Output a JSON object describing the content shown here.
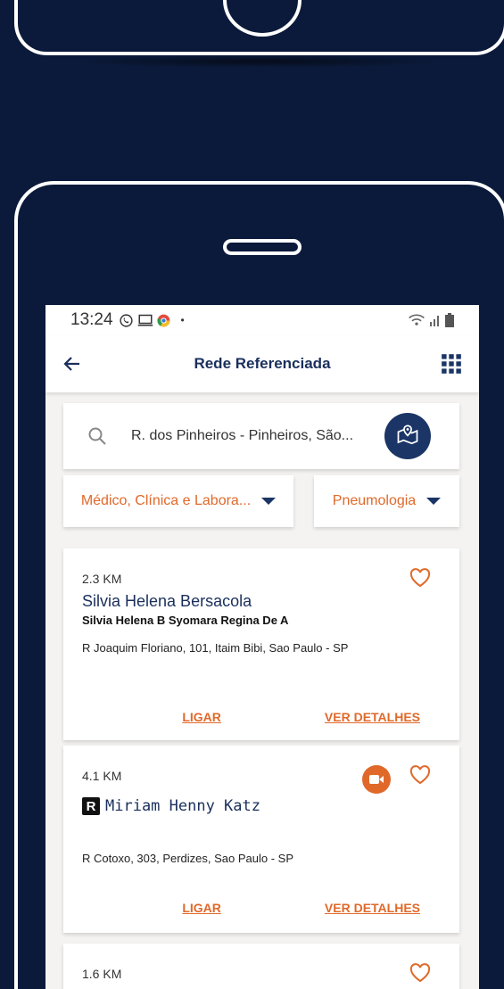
{
  "status_bar": {
    "time": "13:24",
    "left_icons": [
      "whatsapp-icon",
      "cast-icon",
      "chrome-icon",
      "dot-icon"
    ],
    "right_icons": [
      "wifi-icon",
      "signal-icon",
      "battery-icon"
    ]
  },
  "app_bar": {
    "title": "Rede Referenciada",
    "back_icon": "back-arrow-icon",
    "menu_icon": "grid-icon"
  },
  "search": {
    "value": "R. dos Pinheiros - Pinheiros, São...",
    "icon": "search-icon",
    "map_button_icon": "map-pin-icon"
  },
  "filters": [
    {
      "label": "Médico, Clínica e Labora..."
    },
    {
      "label": "Pneumologia"
    }
  ],
  "results": [
    {
      "distance": "2.3 KM",
      "name": "Silvia Helena Bersacola",
      "subname": "Silvia Helena B Syomara Regina De A",
      "address": "R Joaquim Floriano, 101, Itaim Bibi, Sao Paulo - SP",
      "call_label": "LIGAR",
      "details_label": "VER DETALHES"
    },
    {
      "distance": "4.1 KM",
      "badge": "R",
      "name": "Miriam Henny Katz",
      "address": "R Cotoxo, 303, Perdizes, Sao Paulo - SP",
      "call_label": "LIGAR",
      "details_label": "VER DETALHES",
      "video_icon": "video-icon"
    },
    {
      "distance": "1.6 KM"
    }
  ],
  "colors": {
    "background": "#0b1a3a",
    "accent": "#e0692a",
    "primary": "#1a3566"
  }
}
